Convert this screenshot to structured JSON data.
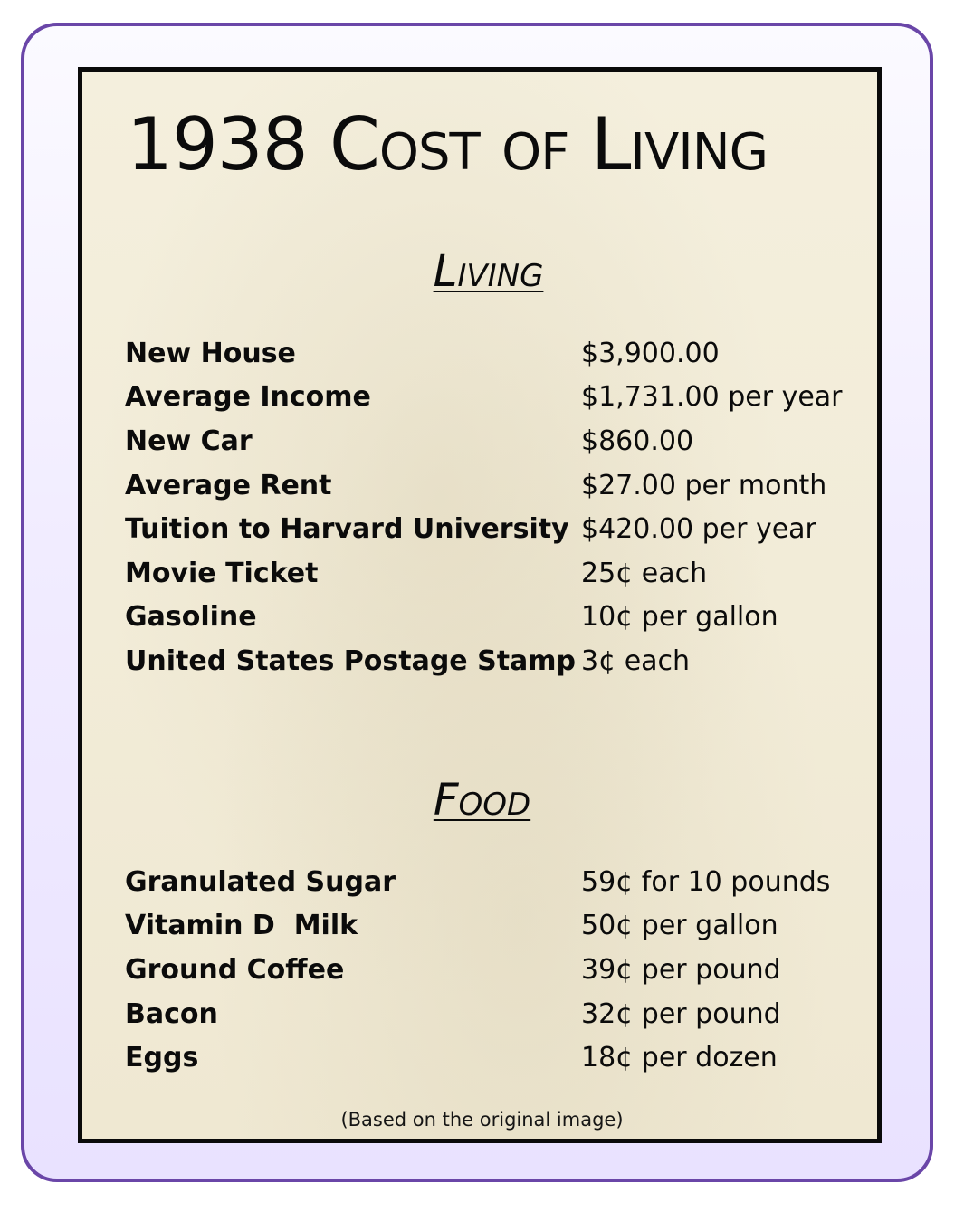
{
  "title": "1938 Cost of Living",
  "sections": [
    {
      "heading": "Living",
      "rows": [
        {
          "item": "New House",
          "price": "$3,900.00"
        },
        {
          "item": "Average Income",
          "price": "$1,731.00 per year"
        },
        {
          "item": "New Car",
          "price": "$860.00"
        },
        {
          "item": "Average Rent",
          "price": "$27.00 per month"
        },
        {
          "item": "Tuition to Harvard University",
          "price": "$420.00 per year"
        },
        {
          "item": "Movie Ticket",
          "price": "25¢ each"
        },
        {
          "item": "Gasoline",
          "price": "10¢ per gallon"
        },
        {
          "item": "United States Postage Stamp",
          "price": "3¢ each"
        }
      ]
    },
    {
      "heading": "Food",
      "rows": [
        {
          "item": "Granulated Sugar",
          "price": "59¢ for 10 pounds"
        },
        {
          "item": "Vitamin D  Milk",
          "price": "50¢ per gallon"
        },
        {
          "item": "Ground Coffee",
          "price": "39¢ per pound"
        },
        {
          "item": "Bacon",
          "price": "32¢ per pound"
        },
        {
          "item": "Eggs",
          "price": "18¢ per dozen"
        }
      ]
    }
  ],
  "footnote": "(Based on the original image)",
  "colors": {
    "frame_border": "#6a46a8",
    "paper": "#f3eedb",
    "paper_border": "#0a0a0a",
    "text": "#0b0b0b"
  }
}
